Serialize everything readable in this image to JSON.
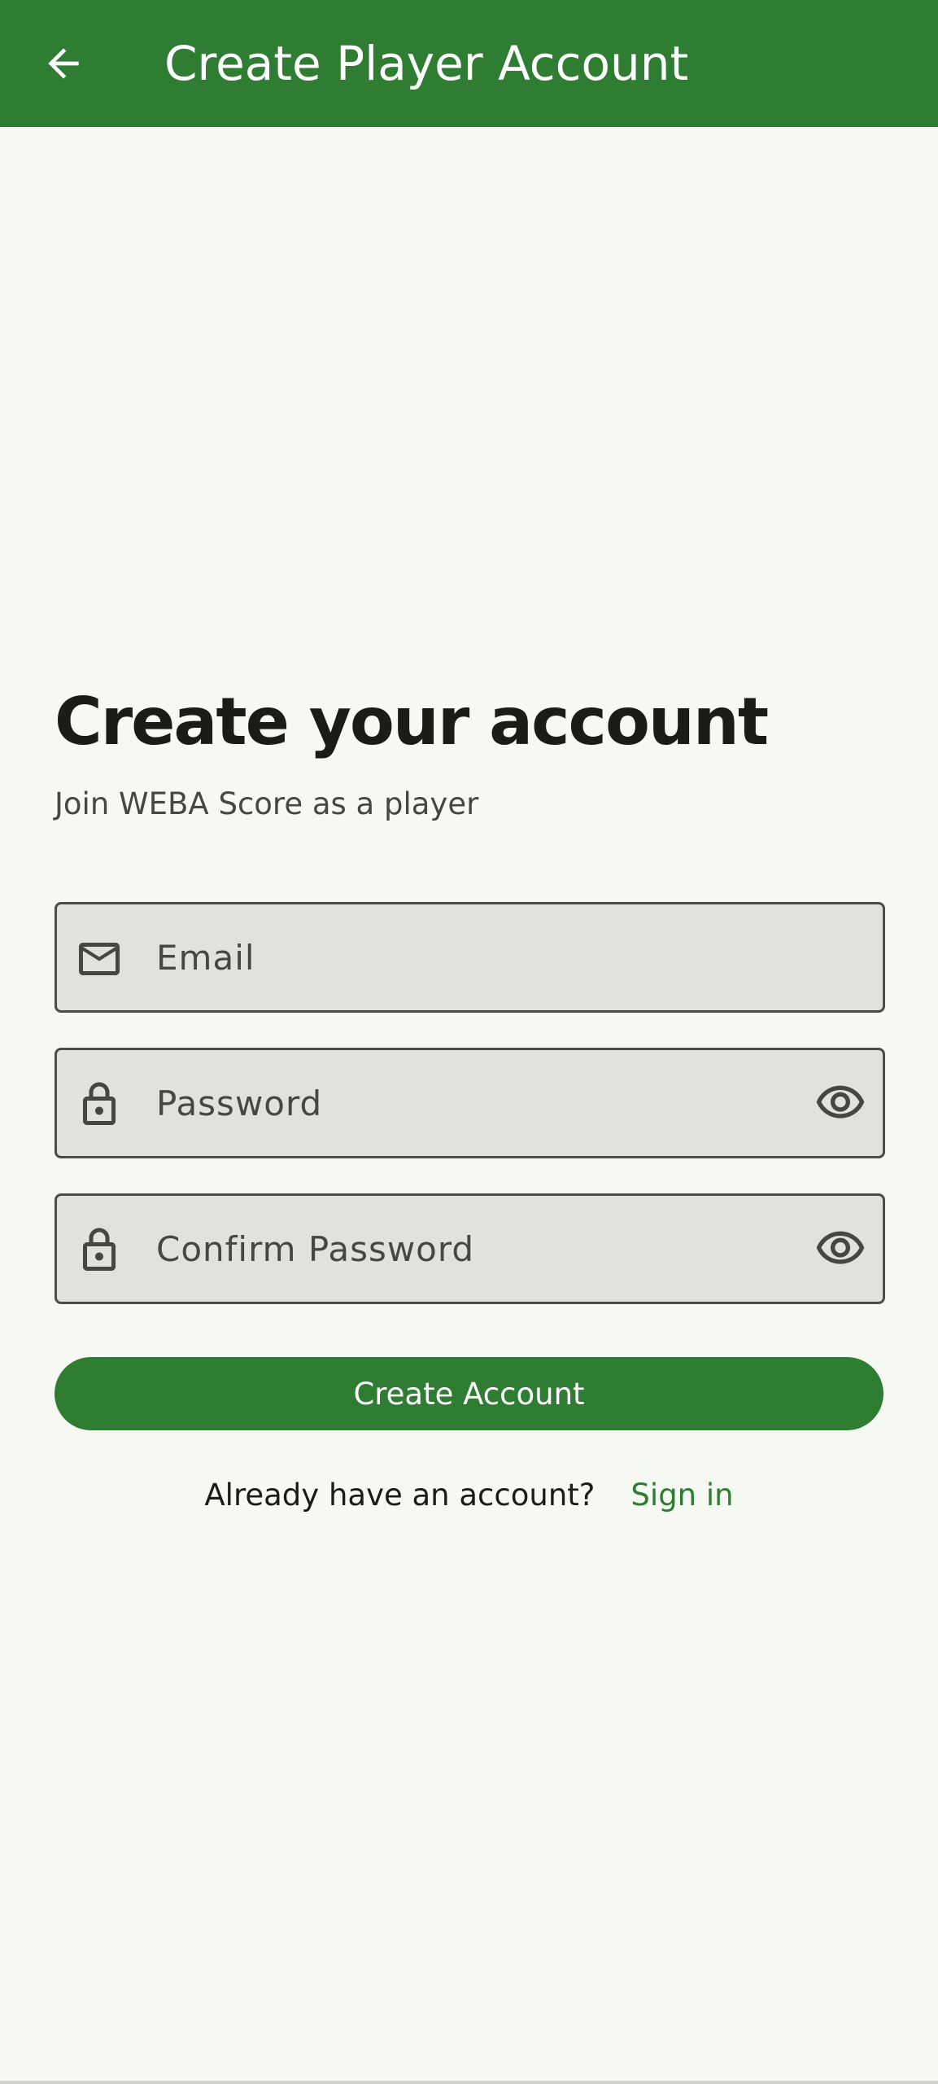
{
  "app_bar": {
    "title": "Create Player Account",
    "back_icon": "arrow-back-icon",
    "background": "#2e7d32"
  },
  "form": {
    "heading": "Create your account",
    "subheading": "Join WEBA Score as a player",
    "email": {
      "placeholder": "Email",
      "value": "",
      "icon": "mail-icon"
    },
    "password": {
      "placeholder": "Password",
      "value": "",
      "icon": "lock-icon",
      "toggle_icon": "eye-icon"
    },
    "confirm_password": {
      "placeholder": "Confirm Password",
      "value": "",
      "icon": "lock-icon",
      "toggle_icon": "eye-icon"
    },
    "submit_label": "Create Account",
    "signin_prompt": "Already have an account?",
    "signin_link": "Sign in"
  },
  "colors": {
    "primary": "#2e7d32",
    "background": "#f6f9f1",
    "field_fill": "#e0e3db",
    "field_border": "#4a4d46",
    "text_primary": "#1b1c18",
    "text_secondary": "#44483f"
  }
}
